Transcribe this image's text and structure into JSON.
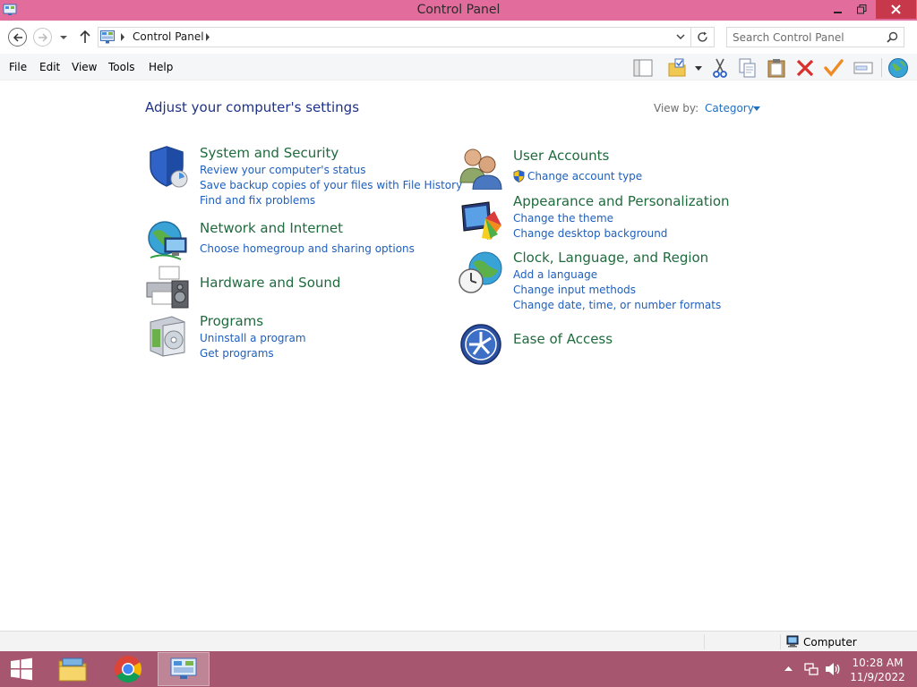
{
  "window": {
    "title": "Control Panel"
  },
  "address": {
    "breadcrumb": "Control Panel"
  },
  "search": {
    "placeholder": "Search Control Panel"
  },
  "menu": {
    "file": "File",
    "edit": "Edit",
    "view": "View",
    "tools": "Tools",
    "help": "Help"
  },
  "content": {
    "heading": "Adjust your computer's settings",
    "view_by_label": "View by:",
    "view_by_value": "Category"
  },
  "categories": {
    "system_security": {
      "title": "System and Security",
      "links": [
        "Review your computer's status",
        "Save backup copies of your files with File History",
        "Find and fix problems"
      ]
    },
    "network_internet": {
      "title": "Network and Internet",
      "links": [
        "Choose homegroup and sharing options"
      ]
    },
    "hardware_sound": {
      "title": "Hardware and Sound"
    },
    "programs": {
      "title": "Programs",
      "links": [
        "Uninstall a program",
        "Get programs"
      ]
    },
    "user_accounts": {
      "title": "User Accounts",
      "links": [
        "Change account type"
      ]
    },
    "appearance": {
      "title": "Appearance and Personalization",
      "links": [
        "Change the theme",
        "Change desktop background"
      ]
    },
    "clock_region": {
      "title": "Clock, Language, and Region",
      "links": [
        "Add a language",
        "Change input methods",
        "Change date, time, or number formats"
      ]
    },
    "ease_access": {
      "title": "Ease of Access"
    }
  },
  "statusbar": {
    "location": "Computer"
  },
  "taskbar": {
    "time": "10:28 AM",
    "date": "11/9/2022"
  },
  "colors": {
    "titlebar": "#e26d9d",
    "taskbar": "#a6566f",
    "link": "#1f5fbd",
    "category": "#1f6b3e",
    "heading": "#1e3287"
  }
}
